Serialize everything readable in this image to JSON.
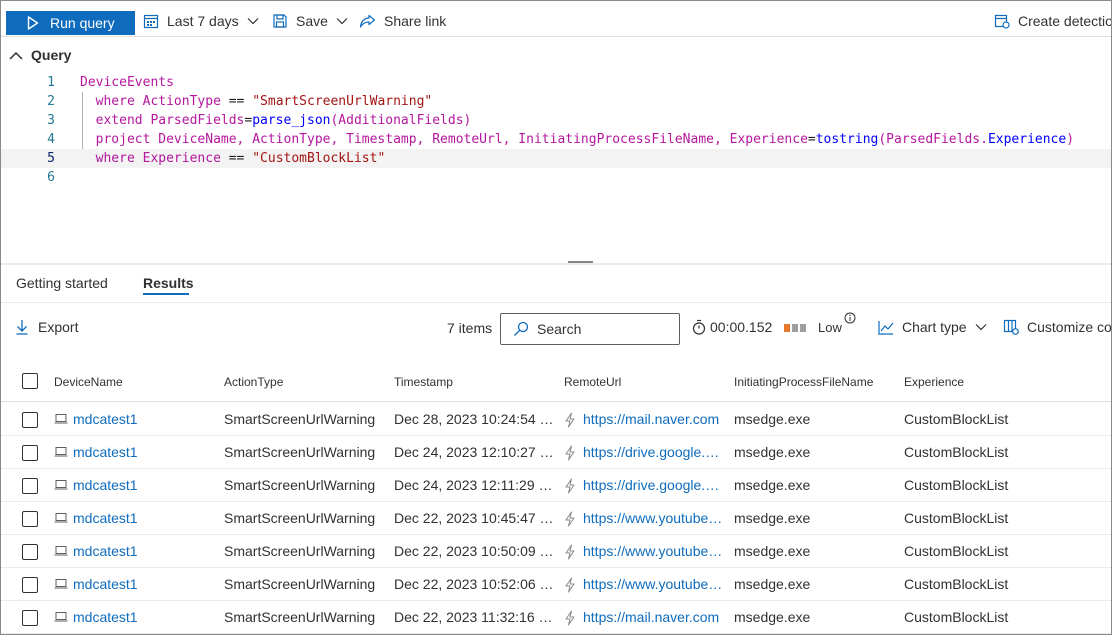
{
  "toolbar": {
    "run_query": "Run query",
    "time_range": "Last 7 days",
    "save": "Save",
    "share_link": "Share link",
    "create_detection": "Create detection rule"
  },
  "query": {
    "section_title": "Query",
    "lines": [
      {
        "n": "1"
      },
      {
        "n": "2"
      },
      {
        "n": "3"
      },
      {
        "n": "4"
      },
      {
        "n": "5"
      },
      {
        "n": "6"
      }
    ],
    "tokens": {
      "l1_table": "DeviceEvents",
      "pipe": "|",
      "l2_where": "where",
      "l2_field": "ActionType",
      "l2_op": "==",
      "l2_value": "\"SmartScreenUrlWarning\"",
      "l3_extend": "extend",
      "l3_field": "ParsedFields",
      "l3_eq": "=",
      "l3_fn": "parse_json",
      "l3_arg": "(AdditionalFields)",
      "l4_project": "project",
      "l4_cols": "DeviceName, ActionType, Timestamp, RemoteUrl, InitiatingProcessFileName, Experience",
      "l4_eq": "=",
      "l4_fn": "tostring",
      "l4_arg_open": "(ParsedFields.",
      "l4_arg_field": "Experience",
      "l4_arg_close": ")",
      "l5_where": "where",
      "l5_field": "Experience",
      "l5_op": "==",
      "l5_value": "\"CustomBlockList\""
    }
  },
  "tabs": {
    "getting_started": "Getting started",
    "results": "Results"
  },
  "results_bar": {
    "export": "Export",
    "item_count": "7 items",
    "search_placeholder": "Search",
    "elapsed": "00:00.152",
    "resource_usage": "Low",
    "chart_type": "Chart type",
    "customize_columns": "Customize columns"
  },
  "colors": {
    "accent": "#0f6cbd",
    "usage_low": "#e8782b",
    "usage_empty": "#a19f9d"
  },
  "table": {
    "headers": [
      "DeviceName",
      "ActionType",
      "Timestamp",
      "RemoteUrl",
      "InitiatingProcessFileName",
      "Experience"
    ],
    "rows": [
      {
        "device": "mdcatest1",
        "action": "SmartScreenUrlWarning",
        "timestamp": "Dec 28, 2023 10:24:54 …",
        "url": "https://mail.naver.com",
        "process": "msedge.exe",
        "experience": "CustomBlockList"
      },
      {
        "device": "mdcatest1",
        "action": "SmartScreenUrlWarning",
        "timestamp": "Dec 24, 2023 12:10:27 P…",
        "url": "https://drive.google.c…",
        "process": "msedge.exe",
        "experience": "CustomBlockList"
      },
      {
        "device": "mdcatest1",
        "action": "SmartScreenUrlWarning",
        "timestamp": "Dec 24, 2023 12:11:29 P…",
        "url": "https://drive.google.c…",
        "process": "msedge.exe",
        "experience": "CustomBlockList"
      },
      {
        "device": "mdcatest1",
        "action": "SmartScreenUrlWarning",
        "timestamp": "Dec 22, 2023 10:45:47 …",
        "url": "https://www.youtube.…",
        "process": "msedge.exe",
        "experience": "CustomBlockList"
      },
      {
        "device": "mdcatest1",
        "action": "SmartScreenUrlWarning",
        "timestamp": "Dec 22, 2023 10:50:09 …",
        "url": "https://www.youtube.…",
        "process": "msedge.exe",
        "experience": "CustomBlockList"
      },
      {
        "device": "mdcatest1",
        "action": "SmartScreenUrlWarning",
        "timestamp": "Dec 22, 2023 10:52:06 …",
        "url": "https://www.youtube.…",
        "process": "msedge.exe",
        "experience": "CustomBlockList"
      },
      {
        "device": "mdcatest1",
        "action": "SmartScreenUrlWarning",
        "timestamp": "Dec 22, 2023 11:32:16 …",
        "url": "https://mail.naver.com",
        "process": "msedge.exe",
        "experience": "CustomBlockList"
      }
    ]
  }
}
